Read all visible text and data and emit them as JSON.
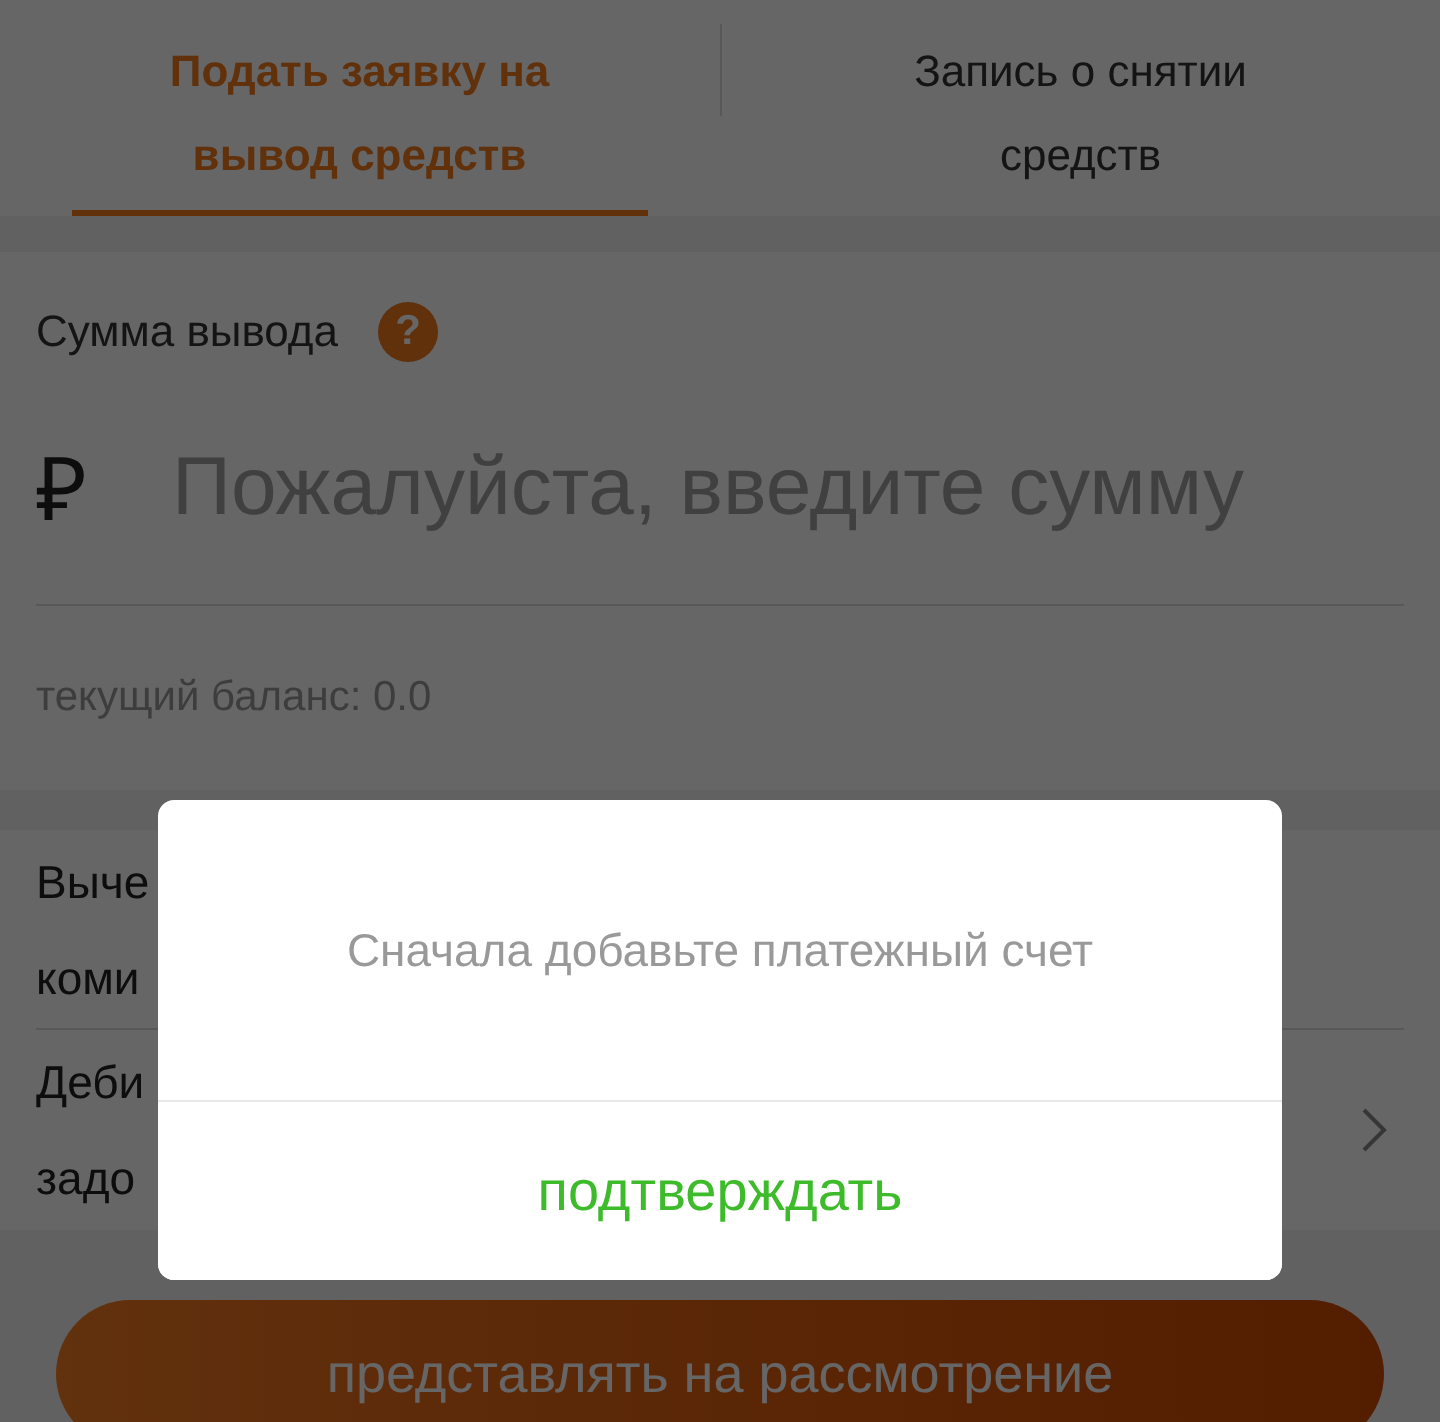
{
  "tabs": [
    {
      "label": "Подать заявку на вывод средств",
      "selected": true
    },
    {
      "label": "Запись о снятии средств",
      "selected": false
    }
  ],
  "amount": {
    "label": "Сумма вывода",
    "help_icon": "?",
    "currency": "₽",
    "placeholder": "Пожалуйста, введите сумму",
    "balance": "текущий баланс: 0.0"
  },
  "rows": [
    {
      "lines": [
        "Выче",
        "коми"
      ],
      "chevron": false
    },
    {
      "lines": [
        "Деби",
        "задо"
      ],
      "chevron": true
    }
  ],
  "submit_button": "представлять на рассмотрение",
  "dialog": {
    "message": "Сначала добавьте платежный счет",
    "confirm": "подтверждать"
  }
}
